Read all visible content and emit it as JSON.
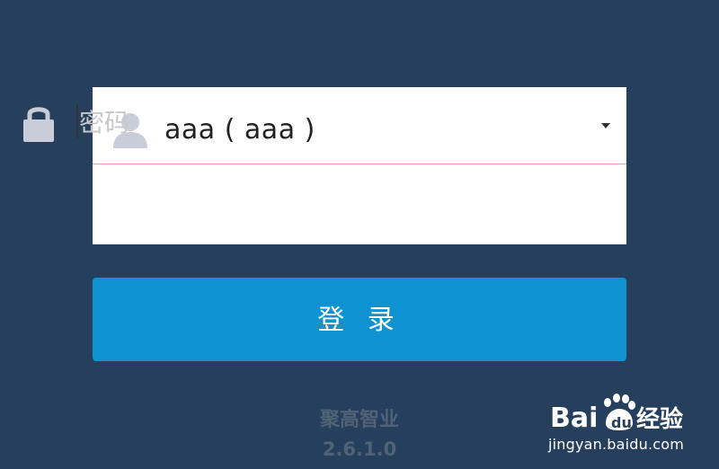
{
  "login": {
    "username_value": "aaa ( aaa )",
    "password_placeholder": "密码",
    "submit_label": "登 录"
  },
  "footer": {
    "company": "聚高智业",
    "version": "2.6.1.0"
  },
  "watermark": {
    "brand": "Baidu经验",
    "url": "jingyan.baidu.com"
  },
  "icons": {
    "user": "user-silhouette-icon",
    "password": "lock-icon",
    "dropdown": "caret-down-icon"
  },
  "colors": {
    "background": "#253f5c",
    "button": "#0f92d1",
    "divider": "#e7a3a6",
    "icon": "#c9cdd9"
  }
}
